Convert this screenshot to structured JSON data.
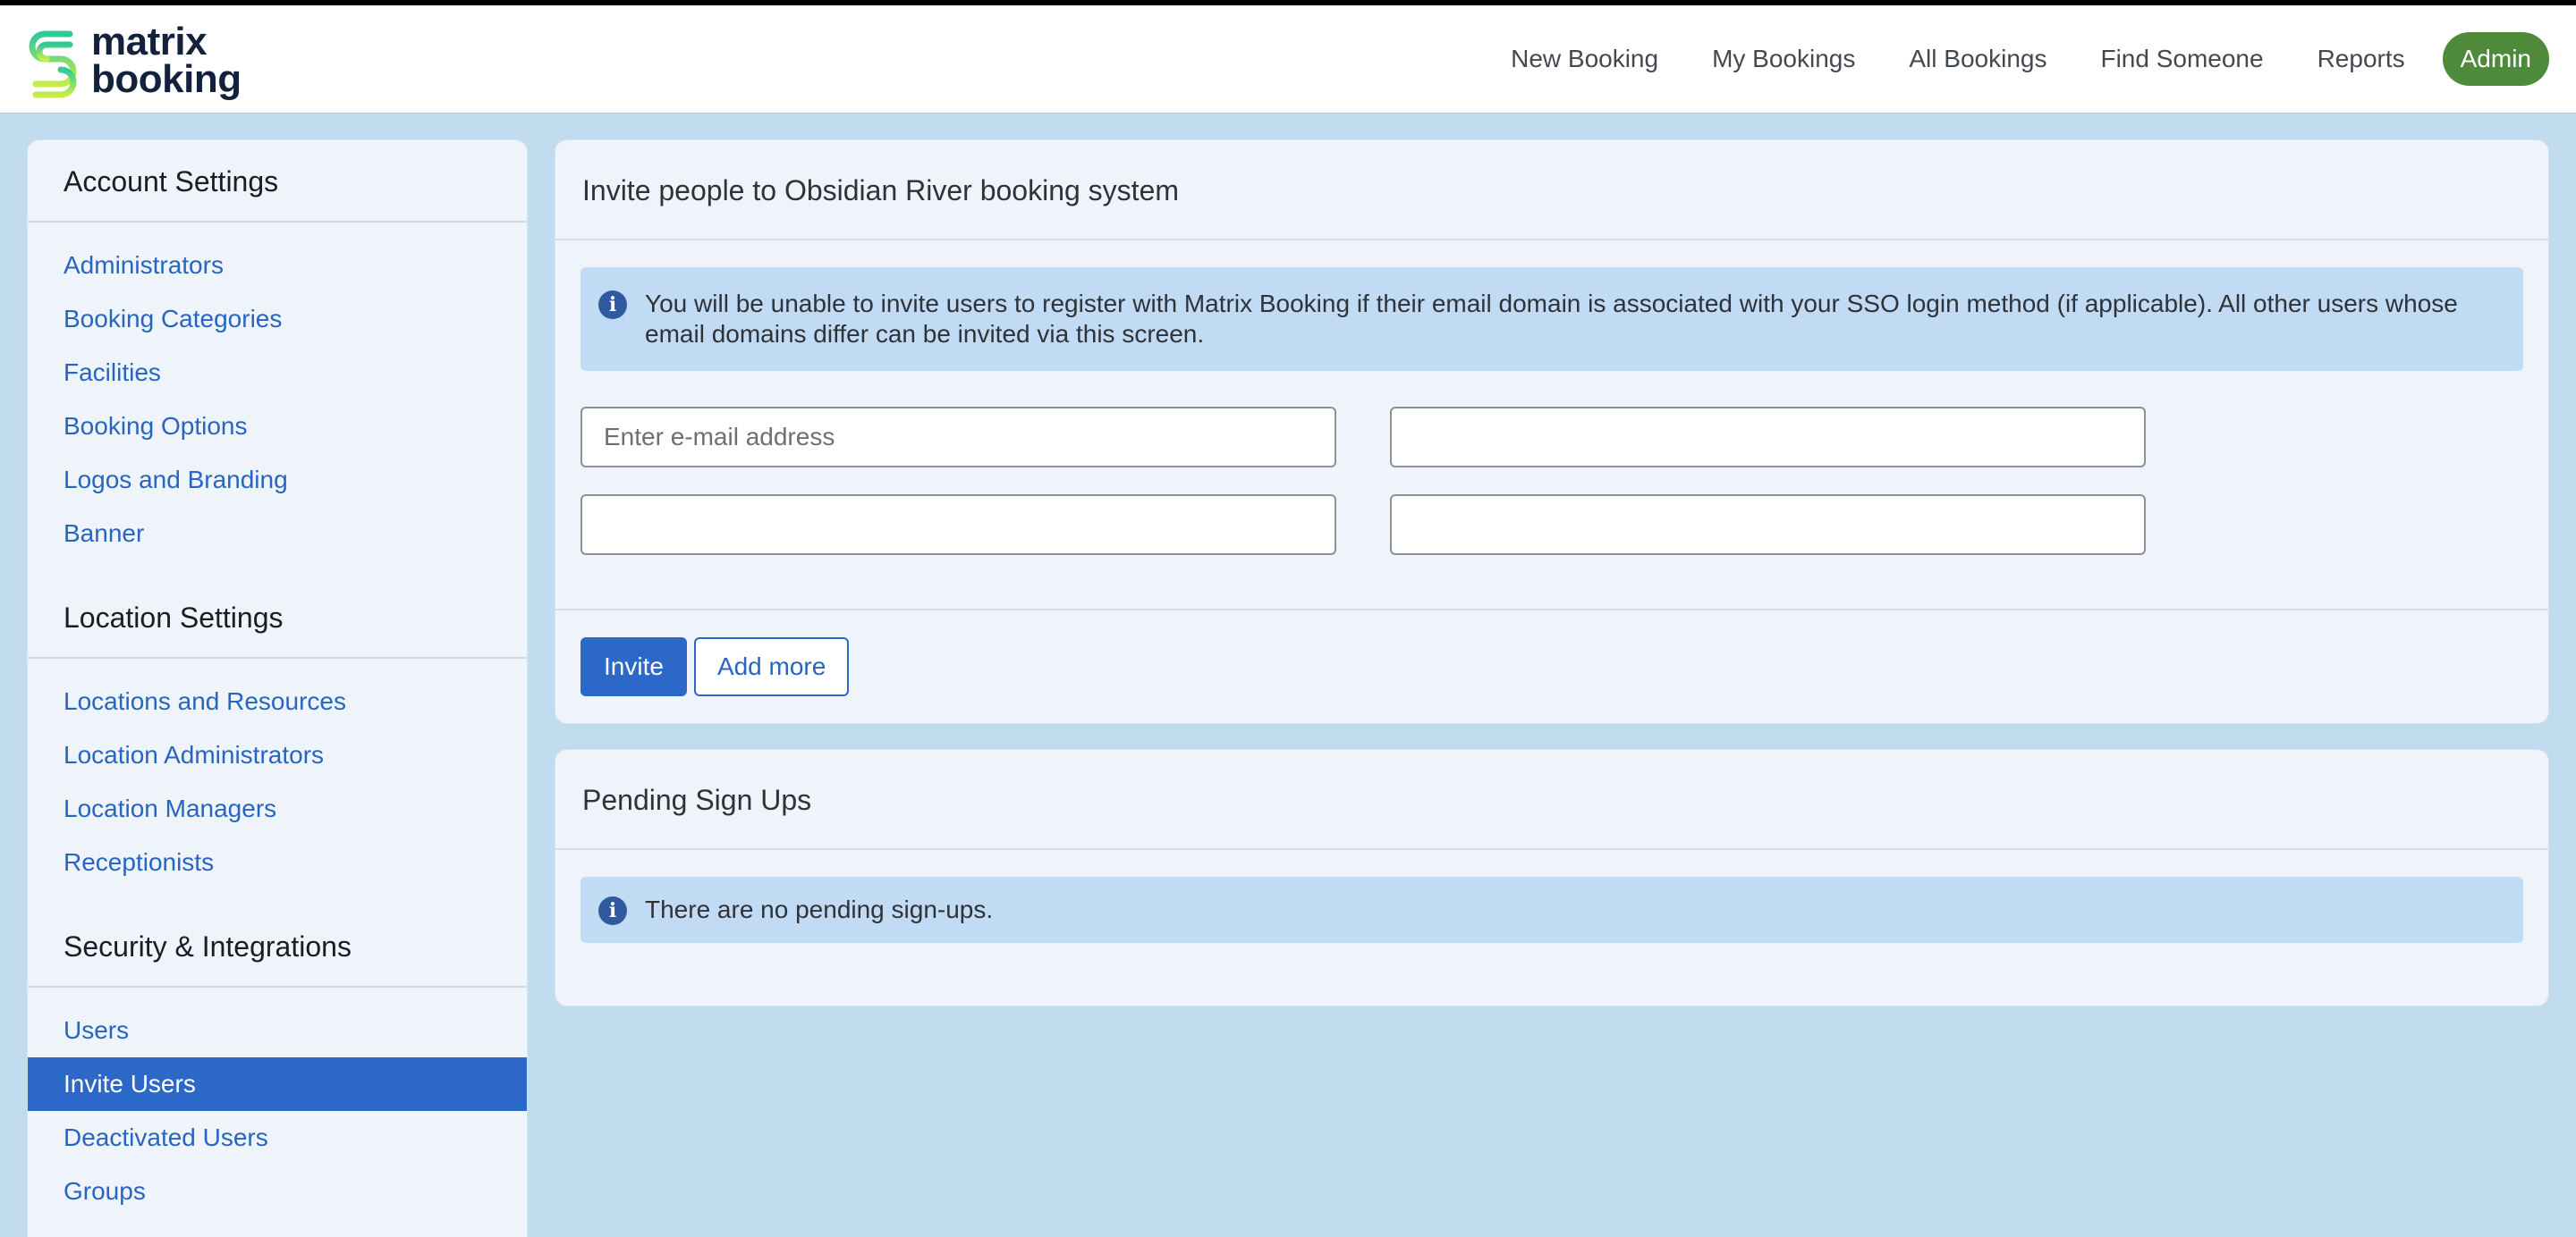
{
  "brand": {
    "line1": "matrix",
    "line2": "booking"
  },
  "nav": {
    "items": [
      "New Booking",
      "My Bookings",
      "All Bookings",
      "Find Someone",
      "Reports"
    ],
    "admin_label": "Admin"
  },
  "sidebar": {
    "sections": [
      {
        "heading": "Account Settings",
        "items": [
          "Administrators",
          "Booking Categories",
          "Facilities",
          "Booking Options",
          "Logos and Branding",
          "Banner"
        ]
      },
      {
        "heading": "Location Settings",
        "items": [
          "Locations and Resources",
          "Location Administrators",
          "Location Managers",
          "Receptionists"
        ]
      },
      {
        "heading": "Security & Integrations",
        "items": [
          "Users",
          "Invite Users",
          "Deactivated Users",
          "Groups"
        ]
      }
    ],
    "active_item": "Invite Users"
  },
  "invite": {
    "title": "Invite people to Obsidian River booking system",
    "info": "You will be unable to invite users to register with Matrix Booking if their email domain is associated with your SSO login method (if applicable). All other users whose email domains differ can be invited via this screen.",
    "email_placeholder": "Enter e-mail address",
    "invite_label": "Invite",
    "add_more_label": "Add more"
  },
  "pending": {
    "title": "Pending Sign Ups",
    "info": "There are no pending sign-ups."
  },
  "colors": {
    "accent": "#2b68c8",
    "admin_badge": "#4f8a3a",
    "background": "#c1dbef",
    "info_bg": "#c1dbf4"
  },
  "icons": {
    "info": "info-icon",
    "logo": "matrix-logo-icon"
  }
}
